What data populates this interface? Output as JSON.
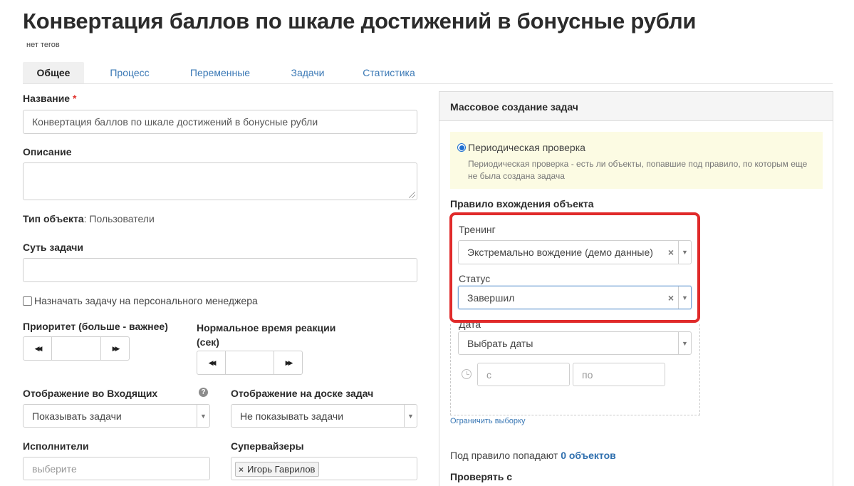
{
  "page": {
    "title": "Конвертация баллов по шкале достижений в бонусные рубли",
    "tags": "нет тегов"
  },
  "tabs": [
    {
      "label": "Общее",
      "active": true
    },
    {
      "label": "Процесс"
    },
    {
      "label": "Переменные"
    },
    {
      "label": "Задачи"
    },
    {
      "label": "Статистика"
    }
  ],
  "form": {
    "name_label": "Название",
    "required_mark": "*",
    "name_value": "Конвертация баллов по шкале достижений в бонусные рубли",
    "description_label": "Описание",
    "description_value": "",
    "object_type_label": "Тип объекта",
    "object_type_value": ": Пользователи",
    "task_essence_label": "Суть задачи",
    "task_essence_value": "",
    "assign_manager_label": "Назначать задачу на персонального менеджера",
    "assign_manager_checked": false,
    "priority_label": "Приоритет (больше - важнее)",
    "priority_value": "",
    "reaction_label_line1": "Нормальное время реакции",
    "reaction_label_line2": "(сек)",
    "reaction_value": "",
    "inbox_display_label": "Отображение во Входящих",
    "inbox_display_value": "Показывать задачи",
    "board_display_label": "Отображение на доске задач",
    "board_display_value": "Не показывать задачи",
    "executors_label": "Исполнители",
    "executors_placeholder": "выберите",
    "supervisors_label": "Супервайзеры",
    "supervisors": [
      "Игорь Гаврилов"
    ],
    "help_glyph": "?"
  },
  "panel": {
    "title": "Массовое создание задач",
    "periodic_label": "Периодическая проверка",
    "periodic_selected": true,
    "periodic_hint": "Периодическая проверка - есть ли объекты, попавшие под правило, по которым еще не была создана задача",
    "rule_label": "Правило вхождения объекта",
    "training_label": "Тренинг",
    "training_value": "Экстремально вождение (демо данные)",
    "status_label": "Статус",
    "status_value": "Завершил",
    "date_label": "Дата",
    "date_value": "Выбрать даты",
    "date_from_placeholder": "с",
    "date_to_placeholder": "по",
    "limit_link": "Ограничить выборку",
    "falls_under_prefix": "Под правило попадают ",
    "falls_under_count": "0 объектов",
    "check_from_label": "Проверять с"
  },
  "glyphs": {
    "prev": "◀◀",
    "next": "▶▶",
    "clear": "×",
    "arrow": "▼",
    "tag_remove": "×"
  },
  "colors": {
    "link": "#3a78b5",
    "highlight_border": "#e02a2a",
    "hint_background": "#fcfbe3",
    "radio": "#1f6fd1"
  }
}
